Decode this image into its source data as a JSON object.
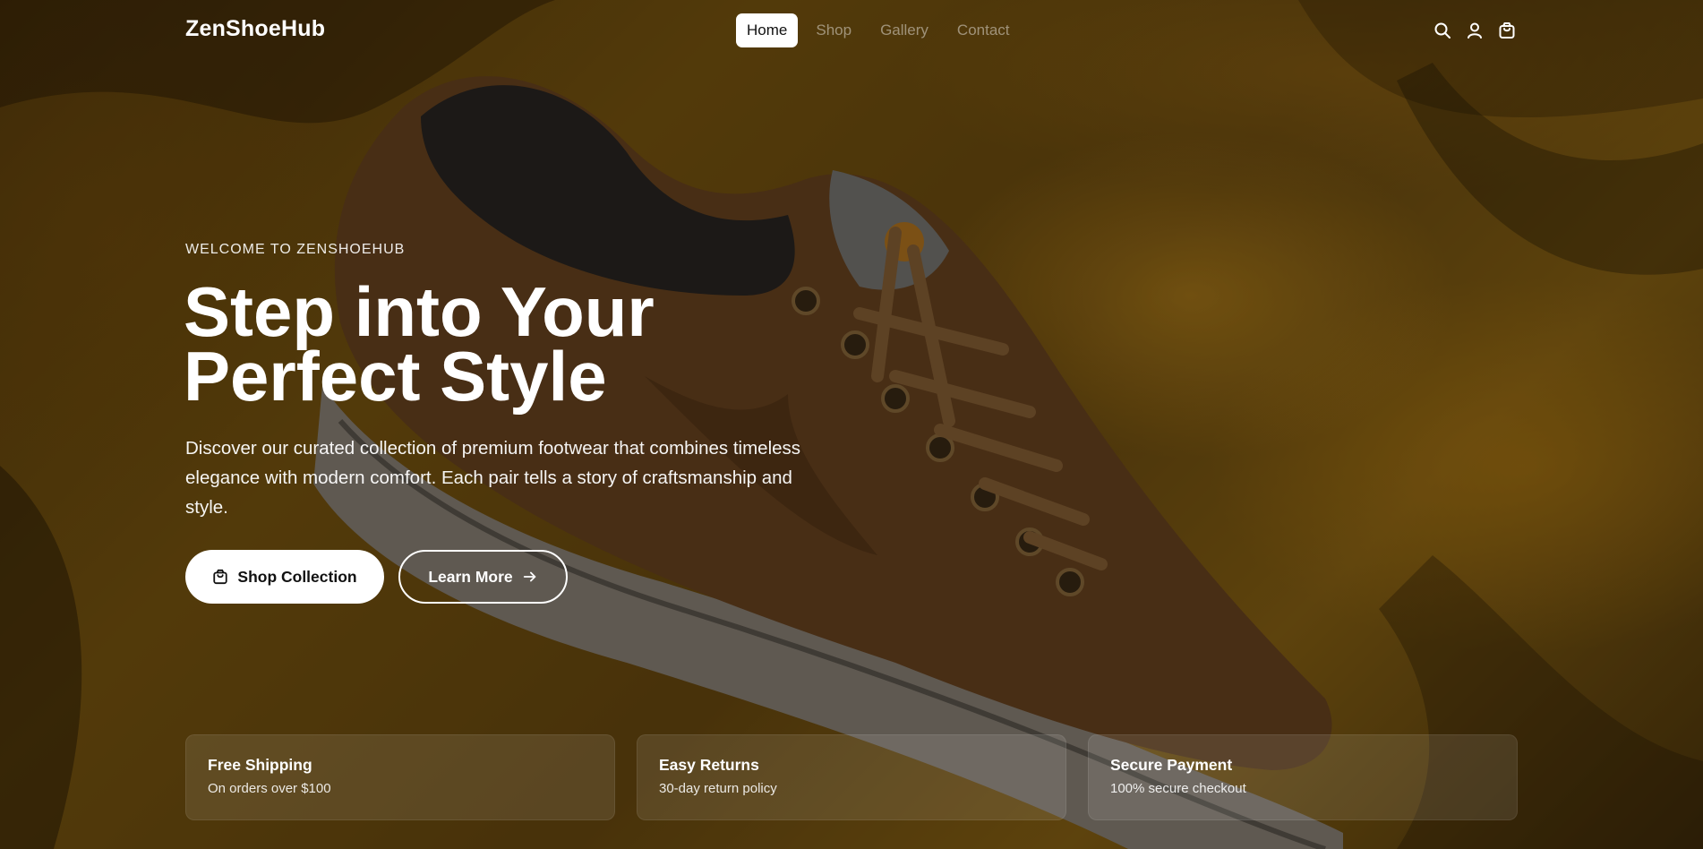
{
  "brand": "ZenShoeHub",
  "nav": {
    "items": [
      {
        "label": "Home",
        "active": true
      },
      {
        "label": "Shop",
        "active": false
      },
      {
        "label": "Gallery",
        "active": false
      },
      {
        "label": "Contact",
        "active": false
      }
    ],
    "icons": [
      "search-icon",
      "user-icon",
      "cart-icon"
    ]
  },
  "hero": {
    "eyebrow": "WELCOME TO ZENSHOEHUB",
    "headline_line1": "Step into Your",
    "headline_line2": "Perfect Style",
    "description": "Discover our curated collection of premium footwear that combines timeless elegance with modern comfort. Each pair tells a story of craftsmanship and style.",
    "primary_button": "Shop Collection",
    "secondary_button": "Learn More"
  },
  "features": [
    {
      "title": "Free Shipping",
      "subtitle": "On orders over $100"
    },
    {
      "title": "Easy Returns",
      "subtitle": "30-day return policy"
    },
    {
      "title": "Secure Payment",
      "subtitle": "100% secure checkout"
    }
  ],
  "colors": {
    "accent": "#ffffff",
    "background": "#6a4a10"
  }
}
